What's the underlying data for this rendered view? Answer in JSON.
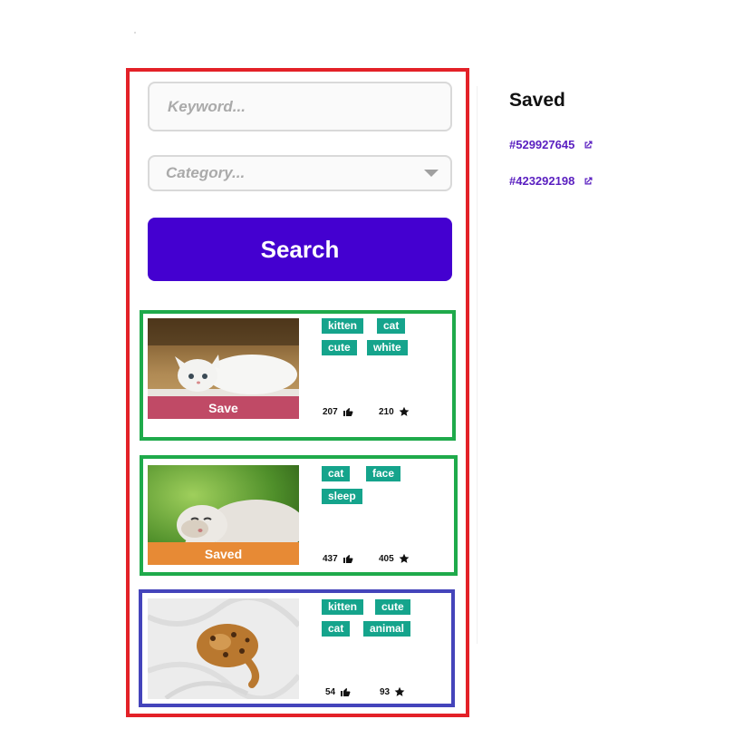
{
  "search": {
    "keyword_placeholder": "Keyword...",
    "keyword_value": "",
    "category_placeholder": "Category...",
    "button_label": "Search"
  },
  "results": [
    {
      "tags": [
        "kitten",
        "cat",
        "cute",
        "white"
      ],
      "likes": "207",
      "stars": "210",
      "action_label": "Save",
      "action_color": "#c04a66",
      "image": "white kitten lying on its back"
    },
    {
      "tags": [
        "cat",
        "face",
        "sleep"
      ],
      "likes": "437",
      "stars": "405",
      "action_label": "Saved",
      "action_color": "#e78a35",
      "image": "cat sleeping upside down on grass"
    },
    {
      "tags": [
        "kitten",
        "cute",
        "cat",
        "animal"
      ],
      "likes": "54",
      "stars": "93",
      "image": "bengal kitten curled on white sheet"
    }
  ],
  "saved": {
    "title": "Saved",
    "items": [
      "#529927645",
      "#423292198"
    ]
  },
  "colors": {
    "accent": "#4400d0",
    "tag": "#15a48c",
    "link": "#5a1fc0",
    "outline_red": "#e32128",
    "outline_green": "#1faa4b",
    "outline_blue": "#4444bb"
  },
  "icons": {
    "likes": "thumbs-up-icon",
    "stars": "star-icon",
    "external": "external-link-icon",
    "dropdown": "chevron-down-icon"
  }
}
